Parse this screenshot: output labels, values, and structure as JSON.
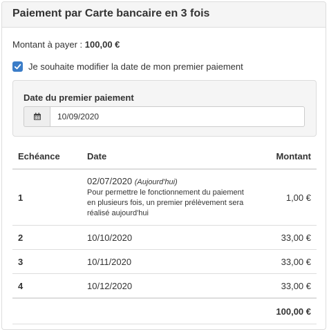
{
  "title": "Paiement par Carte bancaire en 3 fois",
  "amount": {
    "label": "Montant à payer :",
    "value": "100,00 €"
  },
  "modify_checkbox": {
    "label": "Je souhaite modifier la date de mon premier paiement",
    "checked": true
  },
  "first_payment": {
    "label": "Date du premier paiement",
    "value": "10/09/2020",
    "icon": "calendar-icon"
  },
  "table": {
    "headers": {
      "due": "Echéance",
      "date": "Date",
      "amount": "Montant"
    },
    "rows": [
      {
        "num": "1",
        "date": "02/07/2020",
        "today": "(Aujourd'hui)",
        "note": "Pour permettre le fonctionnement du paiement en plusieurs fois, un premier prélèvement sera réalisé aujourd'hui",
        "amount": "1,00 €"
      },
      {
        "num": "2",
        "date": "10/10/2020",
        "amount": "33,00 €"
      },
      {
        "num": "3",
        "date": "10/11/2020",
        "amount": "33,00 €"
      },
      {
        "num": "4",
        "date": "10/12/2020",
        "amount": "33,00 €"
      }
    ],
    "total": "100,00 €"
  },
  "colors": {
    "accent": "#3b7dc8",
    "panel_heading_bg": "#f5f5f5",
    "border": "#dcdcdc"
  }
}
